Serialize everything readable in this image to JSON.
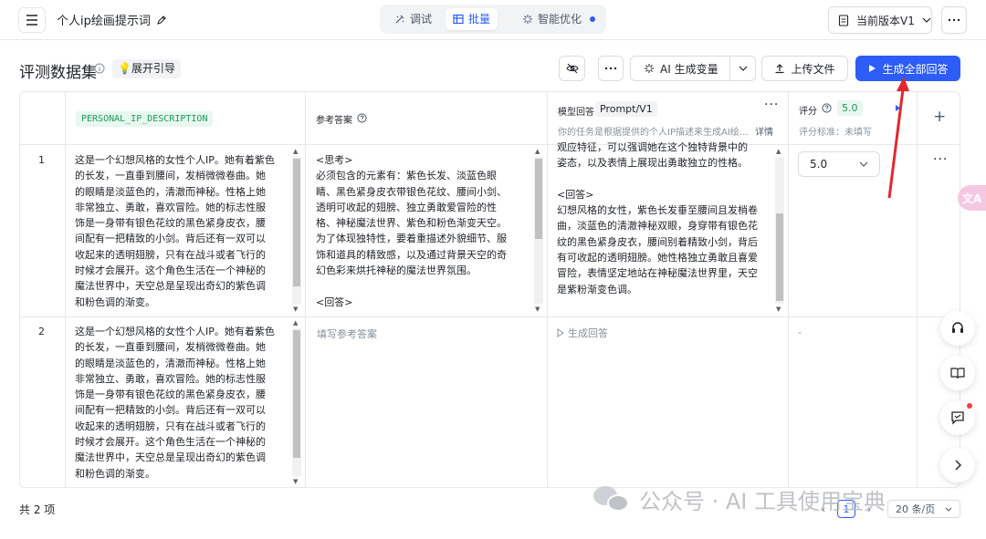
{
  "header": {
    "title": "个人ip绘画提示词",
    "tabs": [
      {
        "label": "调试",
        "icon": "debug-icon"
      },
      {
        "label": "批量",
        "icon": "table-icon",
        "active": true
      },
      {
        "label": "智能优化",
        "icon": "sparkle-icon",
        "dot": true
      }
    ],
    "version_label": "当前版本V1"
  },
  "toolbar": {
    "heading": "评测数据集",
    "guide_label": "展开引导",
    "ai_var_label": "AI 生成变量",
    "upload_label": "上传文件",
    "generate_all_label": "生成全部回答"
  },
  "columns": {
    "var_name": "PERSONAL_IP_DESCRIPTION",
    "reference": "参考答案",
    "model_answer": "模型回答",
    "prompt_version": "Prompt/V1",
    "prompt_preview": "你的任务是根据提供的个人IP描述来生成AI绘…",
    "details": "详情",
    "score": "评分",
    "score_value": "5.0",
    "score_criteria": "评分标准：未填写"
  },
  "rows": [
    {
      "index": "1",
      "description_lines": [
        "这是一个幻想风格的女性个人IP。她有着紫色",
        "的长发，一直垂到腰间，发梢微微卷曲。她",
        "的眼睛是淡蓝色的，清澈而神秘。性格上她",
        "非常独立、勇敢，喜欢冒险。她的标志性服",
        "饰是一身带有银色花纹的黑色紧身皮衣，腰",
        "间配有一把精致的小剑。背后还有一双可以",
        "收起来的透明翅膀，只有在战斗或者飞行的",
        "时候才会展开。这个角色生活在一个神秘的",
        "魔法世界中，天空总是呈现出奇幻的紫色调",
        "和粉色调的渐变。"
      ],
      "reference_lines": [
        "<思考>",
        "必须包含的元素有：紫色长发、淡蓝色眼",
        "睛、黑色紧身皮衣带银色花纹、腰间小剑、",
        "透明可收起的翅膀、独立勇敢爱冒险的性",
        "格、神秘魔法世界、紫色和粉色渐变天空。",
        "为了体现独特性，要着重描述外貌细节、服",
        "饰和道具的精致感，以及通过背景天空的奇",
        "幻色彩来烘托神秘的魔法世界氛围。",
        "",
        "<回答>"
      ],
      "answer_lines": [
        "观应特征，可以强调她在这个独特背景中的",
        "姿态，以及表情上展现出勇敢独立的性格。",
        "",
        "<回答>",
        "幻想风格的女性，紫色长发垂至腰间且发梢卷",
        "曲，淡蓝色的清澈神秘双眼，身穿带有银色花",
        "纹的黑色紧身皮衣，腰间别着精致小剑，背后",
        "有可收起的透明翅膀。她性格独立勇敢且喜爱",
        "冒险，表情坚定地站在神秘魔法世界里，天空",
        "是紫粉渐变色调。"
      ],
      "score": "5.0"
    },
    {
      "index": "2",
      "description_lines": [
        "这是一个幻想风格的女性个人IP。她有着紫色",
        "的长发，一直垂到腰间，发梢微微卷曲。她",
        "的眼睛是淡蓝色的，清澈而神秘。性格上她",
        "非常独立、勇敢，喜欢冒险。她的标志性服",
        "饰是一身带有银色花纹的黑色紧身皮衣，腰",
        "间配有一把精致的小剑。背后还有一双可以",
        "收起来的透明翅膀，只有在战斗或者飞行的",
        "时候才会展开。这个角色生活在一个神秘的",
        "魔法世界中，天空总是呈现出奇幻的紫色调",
        "和粉色调的渐变。"
      ],
      "reference_placeholder": "填写参考答案",
      "answer_action": "生成回答",
      "score": "-"
    }
  ],
  "footer": {
    "total": "共 2 项",
    "page": "1",
    "page_size": "20 条/页"
  },
  "watermark": "公众号 · AI 工具使用宝典",
  "floating": {
    "translate_label": "文A"
  }
}
